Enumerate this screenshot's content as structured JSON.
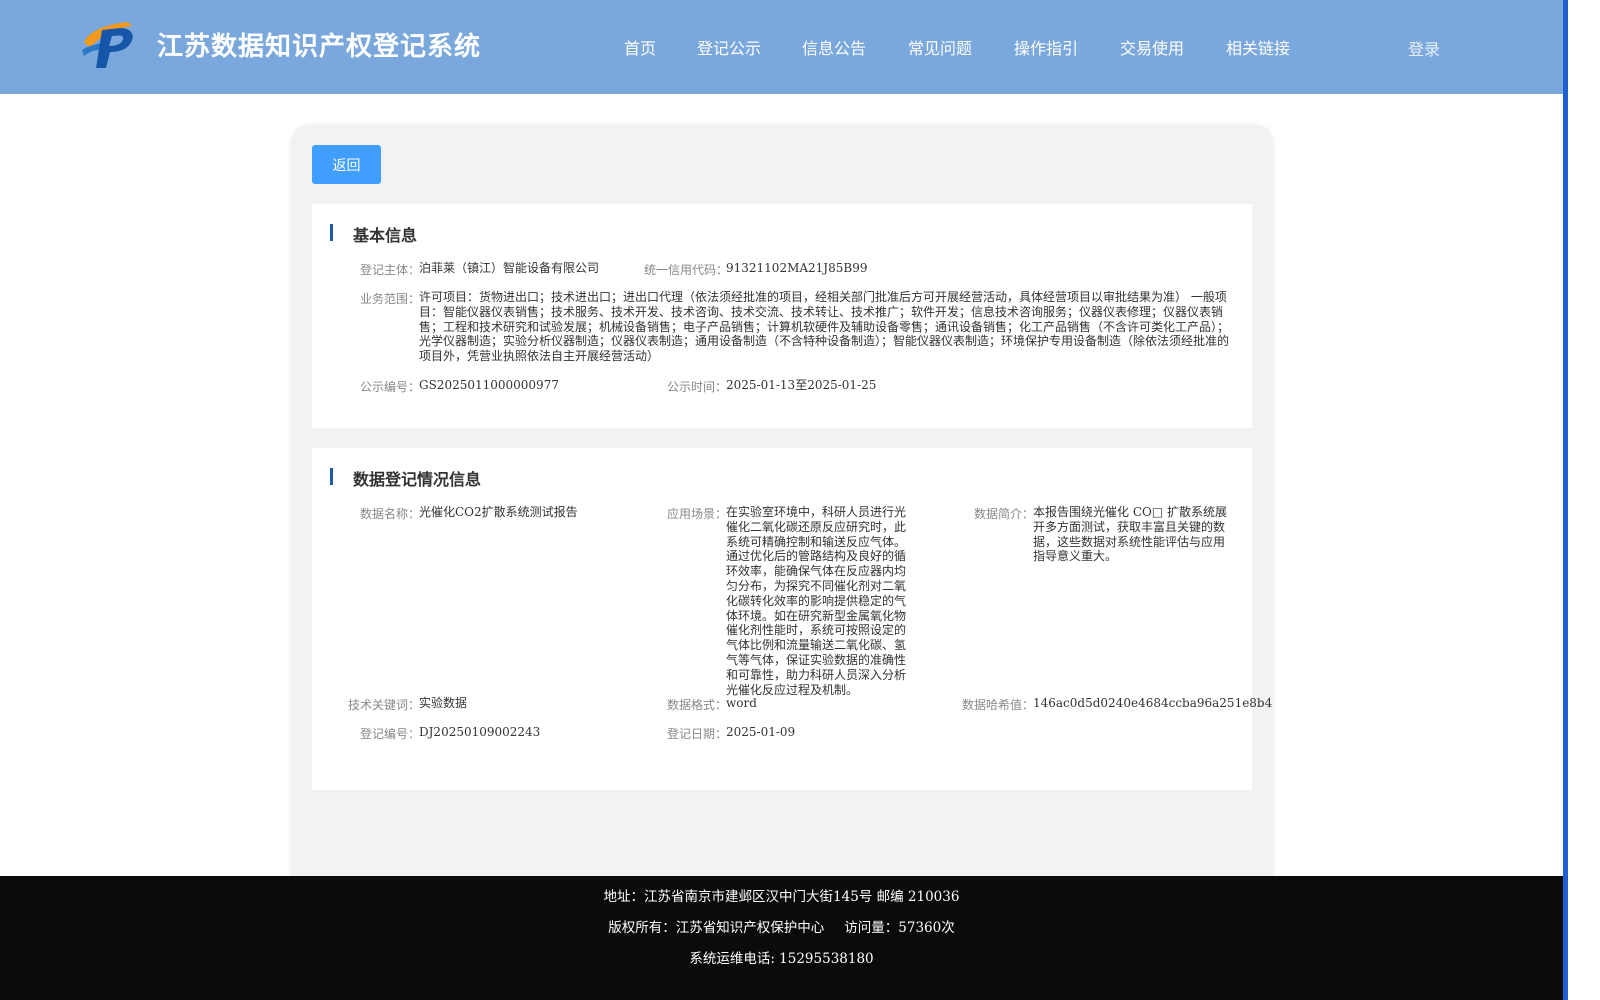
{
  "header": {
    "title": "江苏数据知识产权登记系统",
    "nav": [
      {
        "label": "首页"
      },
      {
        "label": "登记公示"
      },
      {
        "label": "信息公告"
      },
      {
        "label": "常见问题"
      },
      {
        "label": "操作指引"
      },
      {
        "label": "交易使用"
      },
      {
        "label": "相关链接"
      }
    ],
    "login_label": "登录"
  },
  "back_label": "返回",
  "basic_info": {
    "section_title": "基本信息",
    "subject_label": "登记主体：",
    "subject_value": "泊菲莱（镇江）智能设备有限公司",
    "credit_label": "统一信用代码：",
    "credit_value": "91321102MA21J85B99",
    "scope_label": "业务范围：",
    "scope_value": "许可项目：货物进出口；技术进出口；进出口代理（依法须经批准的项目，经相关部门批准后方可开展经营活动，具体经营项目以审批结果为准） 一般项目：智能仪器仪表销售；技术服务、技术开发、技术咨询、技术交流、技术转让、技术推广；软件开发；信息技术咨询服务；仪器仪表修理；仪器仪表销售；工程和技术研究和试验发展；机械设备销售；电子产品销售；计算机软硬件及辅助设备零售；通讯设备销售；化工产品销售（不含许可类化工产品）；光学仪器制造；实验分析仪器制造；仪器仪表制造；通用设备制造（不含特种设备制造）；智能仪器仪表制造；环境保护专用设备制造（除依法须经批准的项目外，凭营业执照依法自主开展经营活动）",
    "pub_no_label": "公示编号：",
    "pub_no_value": "GS2025011000000977",
    "pub_time_label": "公示时间：",
    "pub_time_value": "2025-01-13至2025-01-25"
  },
  "data_info": {
    "section_title": "数据登记情况信息",
    "name_label": "数据名称：",
    "name_value": "光催化CO2扩散系统测试报告",
    "scene_label": "应用场景：",
    "scene_value": "在实验室环境中，科研人员进行光催化二氧化碳还原反应研究时，此系统可精确控制和输送反应气体。通过优化后的管路结构及良好的循环效率，能确保气体在反应器内均匀分布，为探究不同催化剂对二氧化碳转化效率的影响提供稳定的气体环境。如在研究新型金属氧化物催化剂性能时，系统可按照设定的气体比例和流量输送二氧化碳、氢气等气体，保证实验数据的准确性和可靠性，助力科研人员深入分析光催化反应过程及机制。",
    "intro_label": "数据简介：",
    "intro_value": "本报告围绕光催化 CO□ 扩散系统展开多方面测试，获取丰富且关键的数据，这些数据对系统性能评估与应用指导意义重大。",
    "keyword_label": "技术关键词：",
    "keyword_value": "实验数据",
    "format_label": "数据格式：",
    "format_value": "word",
    "hash_label": "数据哈希值：",
    "hash_value": "146ac0d5d0240e4684ccba96a251e8b4",
    "reg_no_label": "登记编号：",
    "reg_no_value": "DJ20250109002243",
    "reg_date_label": "登记日期：",
    "reg_date_value": "2025-01-09"
  },
  "footer": {
    "address": "地址：江苏省南京市建邺区汉中门大街145号 邮编 210036",
    "copyright": "版权所有：江苏省知识产权保护中心",
    "visits": "访问量：57360次",
    "phone": "系统运维电话: 15295538180"
  },
  "colors": {
    "header_bg": "#7aa8dc",
    "button_bg": "#409eff",
    "section_bar": "#1f5aa6",
    "footer_bg": "#0b0b0b"
  }
}
